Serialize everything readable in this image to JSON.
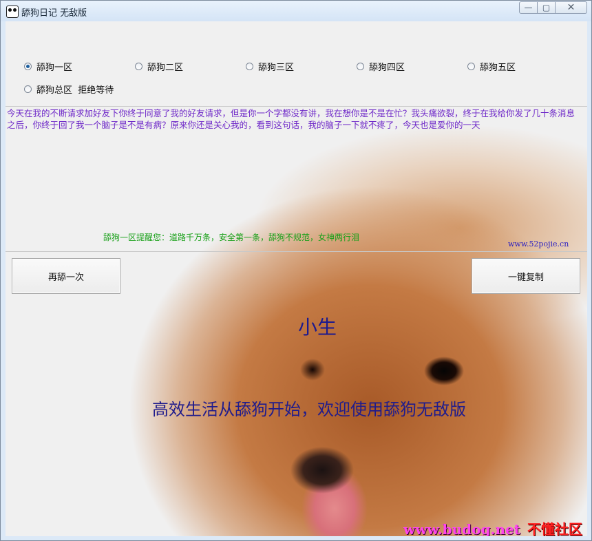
{
  "window": {
    "title": "舔狗日记 无敌版",
    "controls": {
      "minimize": "—",
      "maximize": "▢",
      "close": "✕"
    }
  },
  "zones": {
    "items": [
      {
        "label": "舔狗一区",
        "checked": true
      },
      {
        "label": "舔狗二区",
        "checked": false
      },
      {
        "label": "舔狗三区",
        "checked": false
      },
      {
        "label": "舔狗四区",
        "checked": false
      },
      {
        "label": "舔狗五区",
        "checked": false
      },
      {
        "label": "舔狗总区  拒绝等待",
        "checked": false
      }
    ]
  },
  "diary": {
    "text": "今天在我的不断请求加好友下你终于同意了我的好友请求，但是你一个字都没有讲，我在想你是不是在忙？我头痛欲裂，终于在我给你发了几十条消息之后，你终于回了我一个脑子是不是有病？原来你还是关心我的，看到这句话，我的脑子一下就不疼了，今天也是爱你的一天"
  },
  "reminder": "舔狗一区提醒您：道路千万条，安全第一条，舔狗不规范，女神两行泪",
  "site_link": "www.52pojie.cn",
  "buttons": {
    "again": "再舔一次",
    "copy": "一键复制"
  },
  "overlay": {
    "author": "小生",
    "tagline": "高效生活从舔狗开始，欢迎使用舔狗无敌版"
  },
  "watermark": {
    "url": "www.budog.net",
    "text": "不懂社区"
  },
  "colors": {
    "diary_text": "#6e28c8",
    "reminder_text": "#18a018",
    "overlay_text": "#201c8c",
    "radio_checked": "#1c5f9e"
  }
}
